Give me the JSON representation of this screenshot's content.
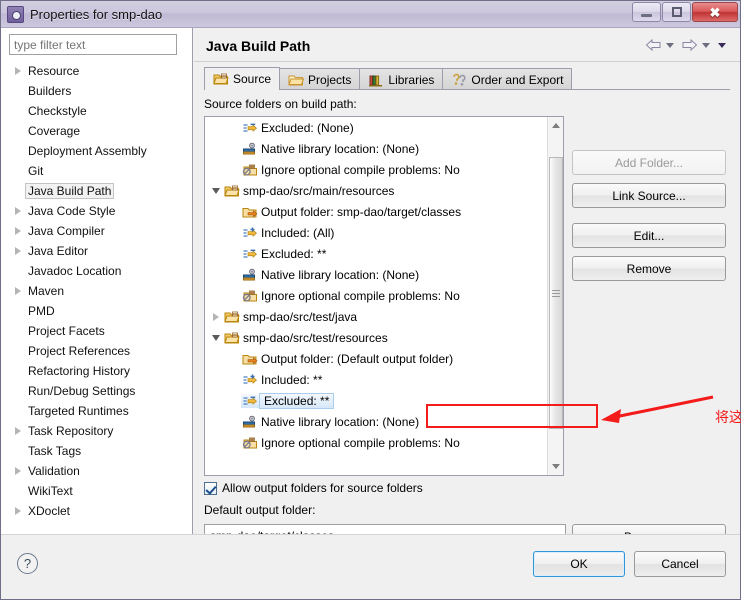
{
  "window": {
    "title": "Properties for smp-dao",
    "icon": "eclipse-properties-icon",
    "controls": {
      "minimize": "–",
      "maximize": "□",
      "close": "✕"
    }
  },
  "filter": {
    "placeholder": "type filter text",
    "value": ""
  },
  "sidebar": {
    "items": [
      {
        "label": "Resource",
        "expandable": true,
        "selected": false
      },
      {
        "label": "Builders",
        "expandable": false,
        "selected": false
      },
      {
        "label": "Checkstyle",
        "expandable": false,
        "selected": false
      },
      {
        "label": "Coverage",
        "expandable": false,
        "selected": false
      },
      {
        "label": "Deployment Assembly",
        "expandable": false,
        "selected": false
      },
      {
        "label": "Git",
        "expandable": false,
        "selected": false
      },
      {
        "label": "Java Build Path",
        "expandable": false,
        "selected": true
      },
      {
        "label": "Java Code Style",
        "expandable": true,
        "selected": false
      },
      {
        "label": "Java Compiler",
        "expandable": true,
        "selected": false
      },
      {
        "label": "Java Editor",
        "expandable": true,
        "selected": false
      },
      {
        "label": "Javadoc Location",
        "expandable": false,
        "selected": false
      },
      {
        "label": "Maven",
        "expandable": true,
        "selected": false
      },
      {
        "label": "PMD",
        "expandable": false,
        "selected": false
      },
      {
        "label": "Project Facets",
        "expandable": false,
        "selected": false
      },
      {
        "label": "Project References",
        "expandable": false,
        "selected": false
      },
      {
        "label": "Refactoring History",
        "expandable": false,
        "selected": false
      },
      {
        "label": "Run/Debug Settings",
        "expandable": false,
        "selected": false
      },
      {
        "label": "Targeted Runtimes",
        "expandable": false,
        "selected": false
      },
      {
        "label": "Task Repository",
        "expandable": true,
        "selected": false
      },
      {
        "label": "Task Tags",
        "expandable": false,
        "selected": false
      },
      {
        "label": "Validation",
        "expandable": true,
        "selected": false
      },
      {
        "label": "WikiText",
        "expandable": false,
        "selected": false
      },
      {
        "label": "XDoclet",
        "expandable": true,
        "selected": false
      }
    ]
  },
  "page": {
    "title": "Java Build Path",
    "nav": {
      "back": "back-arrow-icon",
      "back_menu": "chevron-down-icon",
      "forward": "forward-arrow-icon",
      "forward_menu": "chevron-down-icon",
      "view_menu": "view-menu-icon"
    },
    "tabs": [
      {
        "label": "Source",
        "icon": "source-folder-icon",
        "active": true
      },
      {
        "label": "Projects",
        "icon": "projects-folder-icon",
        "active": false
      },
      {
        "label": "Libraries",
        "icon": "libraries-books-icon",
        "active": false
      },
      {
        "label": "Order and Export",
        "icon": "order-export-icon",
        "active": false
      }
    ],
    "list_label": "Source folders on build path:",
    "rows": [
      {
        "text": "Excluded: (None)",
        "icon": "exclusion-filter-icon",
        "indent": 2,
        "arrow": "none",
        "selected": false
      },
      {
        "text": "Native library location: (None)",
        "icon": "native-library-icon",
        "indent": 2,
        "arrow": "none",
        "selected": false
      },
      {
        "text": "Ignore optional compile problems: No",
        "icon": "ignore-problems-icon",
        "indent": 2,
        "arrow": "none",
        "selected": false
      },
      {
        "text": "smp-dao/src/main/resources",
        "icon": "source-folder-icon",
        "indent": 1,
        "arrow": "expanded",
        "selected": false
      },
      {
        "text": "Output folder: smp-dao/target/classes",
        "icon": "output-folder-icon",
        "indent": 2,
        "arrow": "none",
        "selected": false
      },
      {
        "text": "Included: (All)",
        "icon": "inclusion-filter-icon",
        "indent": 2,
        "arrow": "none",
        "selected": false
      },
      {
        "text": "Excluded: **",
        "icon": "exclusion-filter-icon",
        "indent": 2,
        "arrow": "none",
        "selected": false
      },
      {
        "text": "Native library location: (None)",
        "icon": "native-library-icon",
        "indent": 2,
        "arrow": "none",
        "selected": false
      },
      {
        "text": "Ignore optional compile problems: No",
        "icon": "ignore-problems-icon",
        "indent": 2,
        "arrow": "none",
        "selected": false
      },
      {
        "text": "smp-dao/src/test/java",
        "icon": "source-folder-icon",
        "indent": 1,
        "arrow": "collapsed",
        "selected": false
      },
      {
        "text": "smp-dao/src/test/resources",
        "icon": "source-folder-icon",
        "indent": 1,
        "arrow": "expanded",
        "selected": false
      },
      {
        "text": "Output folder: (Default output folder)",
        "icon": "output-folder-icon",
        "indent": 2,
        "arrow": "none",
        "selected": false
      },
      {
        "text": "Included: **",
        "icon": "inclusion-filter-icon",
        "indent": 2,
        "arrow": "none",
        "selected": false
      },
      {
        "text": "Excluded: **",
        "icon": "exclusion-filter-icon",
        "indent": 2,
        "arrow": "none",
        "selected": true
      },
      {
        "text": "Native library location: (None)",
        "icon": "native-library-icon",
        "indent": 2,
        "arrow": "none",
        "selected": false
      },
      {
        "text": "Ignore optional compile problems: No",
        "icon": "ignore-problems-icon",
        "indent": 2,
        "arrow": "none",
        "selected": false
      }
    ],
    "buttons": {
      "add_folder": "Add Folder...",
      "link_source": "Link Source...",
      "edit": "Edit...",
      "remove": "Remove",
      "browse": "Browse..."
    },
    "allow_output_folders": {
      "label": "Allow output folders for source folders",
      "checked": true
    },
    "default_output": {
      "label": "Default output folder:",
      "value": "smp-dao/target/classes"
    }
  },
  "annotation": {
    "text": "将这一项进行remove掉就好了",
    "color": "#f41b1b"
  },
  "footer": {
    "help": "?",
    "ok": "OK",
    "cancel": "Cancel"
  }
}
